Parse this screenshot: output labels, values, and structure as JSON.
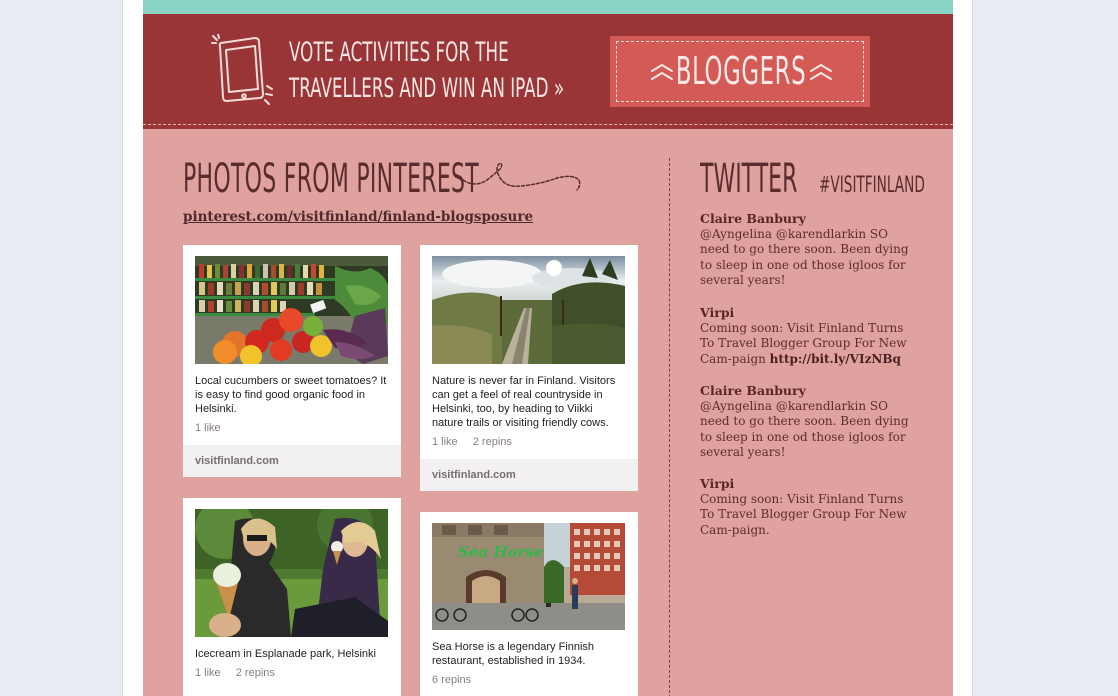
{
  "colors": {
    "teal_bar": "#89d4c2",
    "banner_bg": "#993537",
    "button_bg": "#d45a56",
    "content_bg": "#dfa29f",
    "heading_text": "#5a2c2e"
  },
  "banner": {
    "icon": "ipad-icon",
    "line1": "Vote activities for the",
    "line2": "travellers and win an iPad »",
    "button_label": "BLOGGERS",
    "button_icon": "double-chevron-up-icon"
  },
  "photos": {
    "title": "Photos from pinterest",
    "link": "pinterest.com/visitfinland/finland-blogsposure",
    "pins": [
      {
        "image": "vegetable-market-photo",
        "caption": "Local cucumbers or sweet tomatoes? It is easy to find good organic food in Helsinki.",
        "likes": "1 like",
        "repins": "",
        "source": "visitfinland.com"
      },
      {
        "image": "nature-boardwalk-photo",
        "caption": "Nature is never far in Finland. Visitors can get a feel of real countryside in Helsinki, too, by heading to Viikki nature trails or visiting friendly cows.",
        "likes": "1 like",
        "repins": "2 repins",
        "source": "visitfinland.com"
      },
      {
        "image": "icecream-park-photo",
        "caption": "Icecream in Esplanade park, Helsinki",
        "likes": "1 like",
        "repins": "2 repins",
        "source": ""
      },
      {
        "image": "sea-horse-restaurant-photo",
        "caption": "Sea Horse is a legendary Finnish restaurant, established in 1934.",
        "likes": "",
        "repins": "6 repins",
        "source": ""
      }
    ]
  },
  "twitter": {
    "title": "Twitter",
    "hashtag": "#visitfinland",
    "tweets": [
      {
        "author": "Claire Banbury",
        "text": "@Ayngelina @karendlarkin SO need to go there soon. Been dying to sleep in one od those igloos for several years!",
        "link": ""
      },
      {
        "author": "Virpi",
        "text": "Coming soon: Visit Finland Turns To Travel Blogger Group For New Cam-paign ",
        "link": "http://bit.ly/VIzNBq"
      },
      {
        "author": "Claire Banbury",
        "text": "@Ayngelina @karendlarkin SO need to go there soon. Been dying to sleep in one od those igloos for several years!",
        "link": ""
      },
      {
        "author": "Virpi",
        "text": "Coming soon: Visit Finland Turns To Travel Blogger Group For New Cam-paign.",
        "link": ""
      }
    ]
  }
}
